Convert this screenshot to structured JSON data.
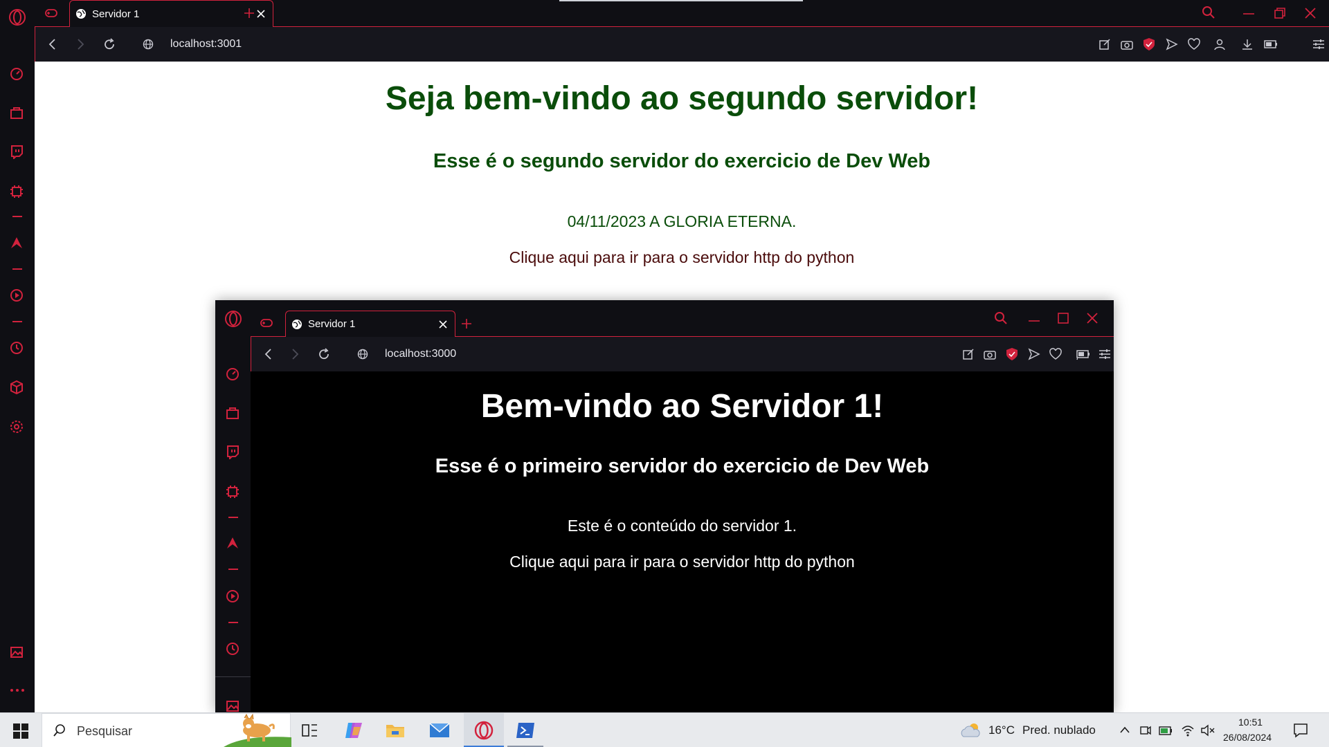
{
  "outer_browser": {
    "tab_title": "Servidor 1",
    "url": "localhost:3001",
    "page": {
      "heading": "Seja bem-vindo ao segundo servidor!",
      "subheading": "Esse é o segundo servidor do exercicio de Dev Web",
      "paragraph": "04/11/2023 A GLORIA ETERNA.",
      "link": "Clique aqui para ir para o servidor http do python",
      "heading_color": "#0a4d0a",
      "link_color": "#4a0b0b"
    }
  },
  "inner_browser": {
    "tab_title": "Servidor 1",
    "url": "localhost:3000",
    "page": {
      "heading": "Bem-vindo ao Servidor 1!",
      "subheading": "Esse é o primeiro servidor do exercicio de Dev Web",
      "paragraph": "Este é o conteúdo do servidor 1.",
      "link": "Clique aqui para ir para o servidor http do python"
    }
  },
  "taskbar": {
    "search_placeholder": "Pesquisar",
    "weather_temp": "16°C",
    "weather_desc": "Pred. nublado",
    "time": "10:51",
    "date": "26/08/2024"
  },
  "theme": {
    "accent": "#d2223d",
    "browser_bg": "#0f0f14",
    "toolbar_bg": "#16161d"
  },
  "icons": [
    "opera-logo-icon",
    "gamepad-icon",
    "globe-icon",
    "close-icon",
    "plus-icon",
    "search-icon",
    "minimize-icon",
    "restore-icon",
    "back-icon",
    "forward-icon",
    "reload-icon",
    "snapshot-icon",
    "camera-icon",
    "shield-icon",
    "send-icon",
    "heart-icon",
    "user-icon",
    "download-icon",
    "battery-icon",
    "settings-sliders-icon",
    "speed-dial-icon",
    "bag-icon",
    "twitch-icon",
    "chip-icon",
    "aria-icon",
    "play-icon",
    "clock-icon",
    "cube-icon",
    "gear-icon",
    "image-icon",
    "more-icon",
    "windows-icon",
    "task-view-icon",
    "copilot-icon",
    "folder-icon",
    "mail-icon",
    "terminal-icon",
    "cloud-icon",
    "chevron-up-icon",
    "meet-icon",
    "wifi-icon",
    "mute-icon",
    "notification-icon"
  ]
}
